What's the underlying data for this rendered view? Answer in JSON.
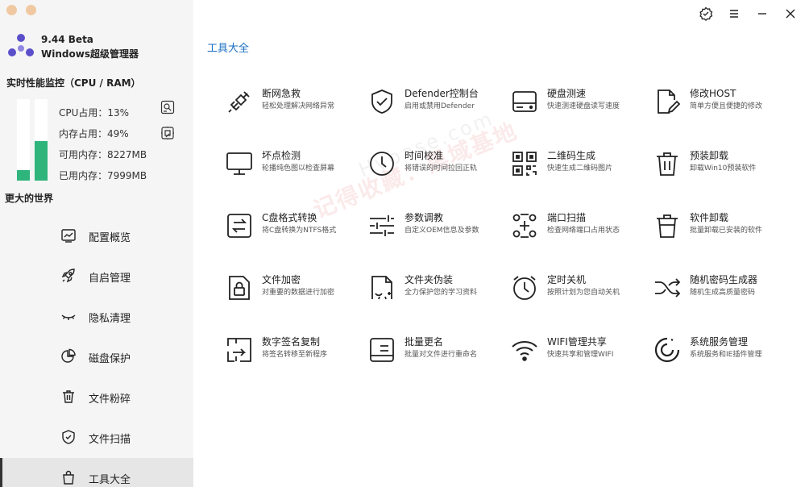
{
  "app": {
    "version": "9.44 Beta",
    "name": "Windows超级管理器"
  },
  "monitor": {
    "title": "实时性能监控（CPU / RAM）",
    "cpu_label": "CPU占用：13%",
    "cpu_level": 0.13,
    "mem_label": "内存占用：49%",
    "mem_level": 0.49,
    "available_label": "可用内存：",
    "available_value": "8227MB",
    "used_label": "已用内存：",
    "used_value": "7999MB",
    "bar_color": "#2fb47c"
  },
  "slogan": "更大的世界",
  "nav": [
    {
      "label": "配置概览",
      "icon": "chart-icon"
    },
    {
      "label": "自启管理",
      "icon": "rocket-icon"
    },
    {
      "label": "隐私清理",
      "icon": "eye-closed-icon"
    },
    {
      "label": "磁盘保护",
      "icon": "pie-chart-icon"
    },
    {
      "label": "文件粉碎",
      "icon": "trash-icon"
    },
    {
      "label": "文件扫描",
      "icon": "shield-check-icon"
    },
    {
      "label": "工具大全",
      "icon": "bag-icon",
      "active": true
    }
  ],
  "main": {
    "title": "工具大全",
    "accent": "#1a6fc2"
  },
  "tools": [
    {
      "title": "断网急救",
      "desc": "轻松处理解决网络异常",
      "icon": "plug-icon"
    },
    {
      "title": "Defender控制台",
      "desc": "启用或禁用Defender",
      "icon": "shield-icon"
    },
    {
      "title": "硬盘测速",
      "desc": "快速测速硬盘读写速度",
      "icon": "hard-disk-icon"
    },
    {
      "title": "修改HOST",
      "desc": "简单方便且便捷的修改",
      "icon": "edit-file-icon"
    },
    {
      "title": "坏点检测",
      "desc": "轮播纯色图以检查屏幕",
      "icon": "monitor-icon"
    },
    {
      "title": "时间校准",
      "desc": "将错误的时间拉回正轨",
      "icon": "clock-icon"
    },
    {
      "title": "二维码生成",
      "desc": "快速生成二维码图片",
      "icon": "qr-code-icon"
    },
    {
      "title": "预装卸载",
      "desc": "卸载Win10预装软件",
      "icon": "trash-can-icon"
    },
    {
      "title": "C盘格式转换",
      "desc": "将C盘转换为NTFS格式",
      "icon": "swap-icon"
    },
    {
      "title": "参数调教",
      "desc": "自定义OEM信息及参数",
      "icon": "sliders-icon"
    },
    {
      "title": "端口扫描",
      "desc": "检查网络端口占用状态",
      "icon": "scan-icon"
    },
    {
      "title": "软件卸载",
      "desc": "批量卸载已安装的软件",
      "icon": "trash-icon"
    },
    {
      "title": "文件加密",
      "desc": "对重要的数据进行加密",
      "icon": "lock-file-icon"
    },
    {
      "title": "文件夹伪装",
      "desc": "全力保护您的学习资料",
      "icon": "disguise-file-icon"
    },
    {
      "title": "定时关机",
      "desc": "按照计划为您自动关机",
      "icon": "alarm-clock-icon"
    },
    {
      "title": "随机密码生成器",
      "desc": "随机生成高质量密码",
      "icon": "shuffle-icon"
    },
    {
      "title": "数字签名复制",
      "desc": "将签名转移至新程序",
      "icon": "signature-copy-icon"
    },
    {
      "title": "批量更名",
      "desc": "批量对文件进行重命名",
      "icon": "rename-icon"
    },
    {
      "title": "WIFI管理共享",
      "desc": "快速共享和管理WIFI",
      "icon": "wifi-icon"
    },
    {
      "title": "系统服务管理",
      "desc": "系统服务和IE插件管理",
      "icon": "service-ring-icon"
    }
  ],
  "watermark": {
    "cn": "记得收藏：黑域基地",
    "en": "Hybase.com"
  }
}
